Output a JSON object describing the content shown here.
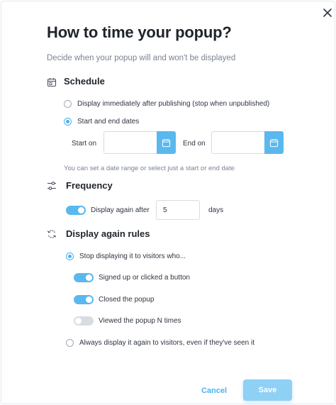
{
  "dialog": {
    "title": "How to time your popup?",
    "subtitle": "Decide when your popup will and won't be displayed",
    "close_icon": "close-icon"
  },
  "schedule": {
    "title": "Schedule",
    "icon": "calendar-icon",
    "options": [
      {
        "label": "Display immediately after publishing (stop when unpublished)",
        "selected": false
      },
      {
        "label": "Start and end dates",
        "selected": true
      }
    ],
    "start_label": "Start on",
    "end_label": "End on",
    "start_value": "",
    "end_value": "",
    "hint": "You can set a date range or select just a start or end date"
  },
  "frequency": {
    "title": "Frequency",
    "icon": "sliders-icon",
    "toggle_on": true,
    "label": "Display again after",
    "value": "5",
    "unit": "days"
  },
  "rules": {
    "title": "Display again rules",
    "icon": "refresh-icon",
    "option_stop": {
      "label": "Stop displaying it to visitors who...",
      "selected": true
    },
    "conditions": [
      {
        "label": "Signed up or clicked a button",
        "on": true
      },
      {
        "label": "Closed the popup",
        "on": true
      },
      {
        "label": "Viewed the popup N times",
        "on": false
      }
    ],
    "option_always": {
      "label": "Always display it again to visitors, even if they've seen it",
      "selected": false
    }
  },
  "footer": {
    "cancel_label": "Cancel",
    "save_label": "Save"
  },
  "colors": {
    "accent": "#5ab8ef",
    "save_button": "#8fd0f5",
    "toggle_off": "#d9dce1"
  }
}
